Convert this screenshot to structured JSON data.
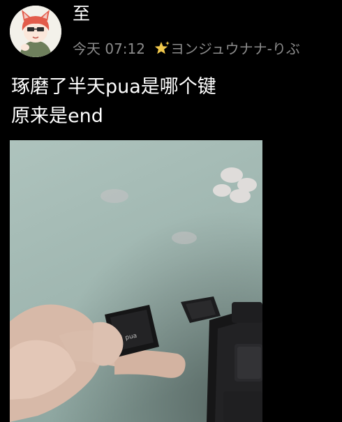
{
  "user": {
    "name": "至",
    "time": "今天 07:12",
    "signature": "ヨンジュウナナ-りぶ",
    "signature_icon": "star-sparkle-icon"
  },
  "post": {
    "text": "琢磨了半天pua是哪个键\n原来是end"
  },
  "photo": {
    "keycap_label": "pua"
  },
  "colors": {
    "background": "#000000",
    "meta_text": "#8c8c8c",
    "star": "#f2c94c"
  }
}
